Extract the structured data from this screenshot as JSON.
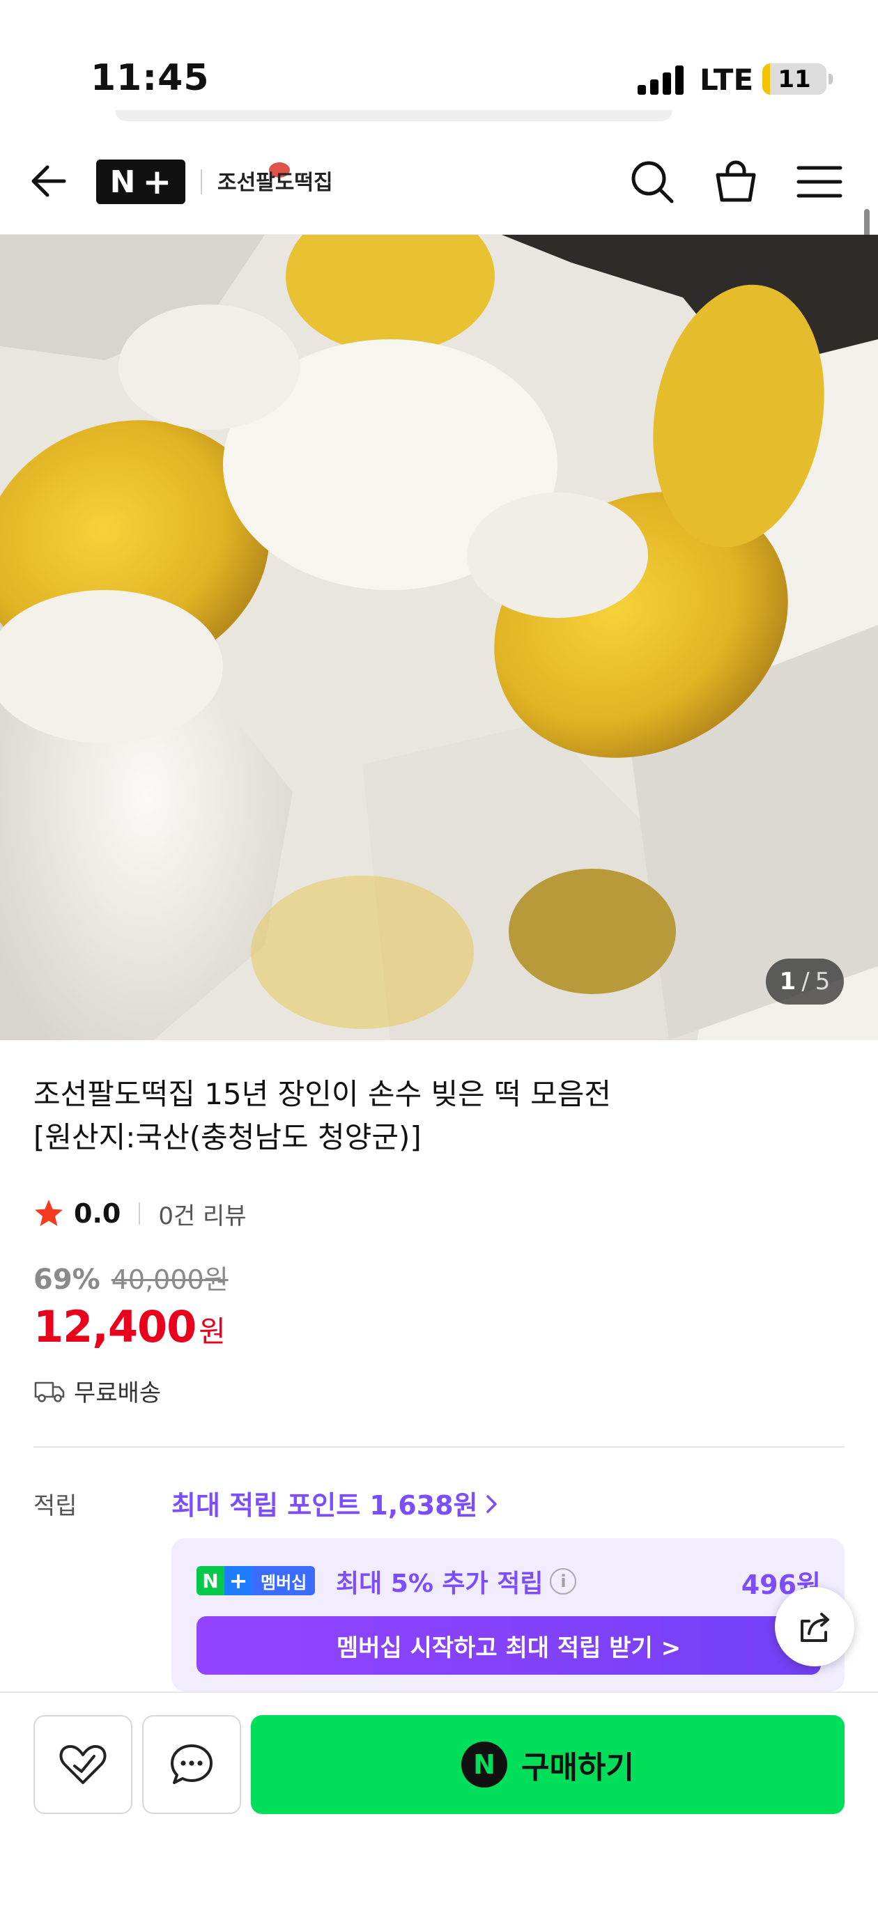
{
  "status": {
    "time": "11:45",
    "network": "LTE",
    "battery": "11",
    "battery_level": 0.11
  },
  "header": {
    "logo_text": "N",
    "logo_plus": "+",
    "brand": "조선팔도떡집",
    "icons": [
      "back-arrow-icon",
      "search-icon",
      "shopping-bag-icon",
      "menu-icon"
    ]
  },
  "gallery": {
    "current": "1",
    "separator": "/",
    "total": "5"
  },
  "product": {
    "title_line1": "조선팔도떡집 15년 장인이 손수 빚은 떡 모음전",
    "title_line2": "[원산지:국산(충청남도 청양군)]",
    "rating": "0.0",
    "review_count": "0건 리뷰",
    "discount": "69%",
    "original_price": "40,000원",
    "price": "12,400",
    "price_unit": "원",
    "shipping": "무료배송"
  },
  "points": {
    "label": "적립",
    "max_points": "최대 적립 포인트 1,638원",
    "membership_badge": "멤버십",
    "membership_n": "N",
    "membership_plus": "+",
    "membership_info": "최대 5% 추가 적립",
    "membership_amount": "496원",
    "membership_cta": "멤버십 시작하고 최대 적립 받기 >"
  },
  "bottom_bar": {
    "buy_label": "구매하기",
    "buy_icon_letter": "N"
  },
  "colors": {
    "price_red": "#e8001c",
    "purple": "#7b4dff",
    "buy_green": "#00de5a"
  }
}
